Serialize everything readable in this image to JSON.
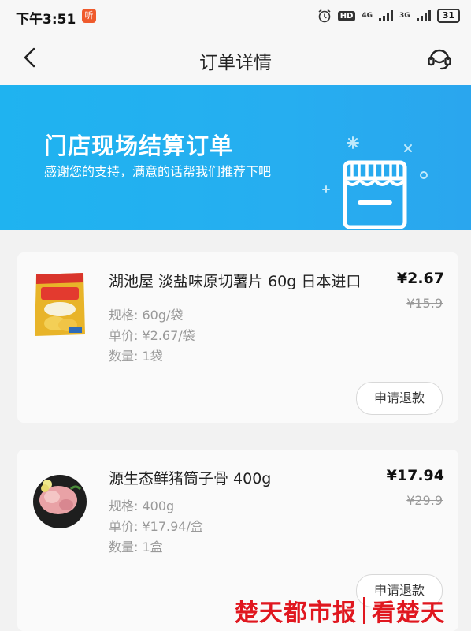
{
  "status_bar": {
    "time": "下午3:51",
    "notification_badge": "听",
    "hd": "HD",
    "network_1": "4G",
    "network_2": "3G",
    "battery": "31"
  },
  "nav": {
    "title": "订单详情",
    "back_icon": "chevron-left-icon",
    "service_icon": "customer-service-icon"
  },
  "banner": {
    "headline": "门店现场结算订单",
    "subtitle": "感谢您的支持，满意的话帮我们推荐下吧",
    "illustration_icon": "storefront-icon",
    "background": "#22aef0"
  },
  "products": [
    {
      "name": "湖池屋 淡盐味原切薯片 60g 日本进口",
      "price": "¥2.67",
      "original_price": "¥15.9",
      "spec": "规格: 60g/袋",
      "unit_price": "单价: ¥2.67/袋",
      "quantity": "数量: 1袋",
      "refund_label": "申请退款"
    },
    {
      "name": "源生态鲜猪筒子骨 400g",
      "price": "¥17.94",
      "original_price": "¥29.9",
      "spec": "规格: 400g",
      "unit_price": "单价: ¥17.94/盒",
      "quantity": "数量: 1盒",
      "refund_label": "申请退款"
    }
  ],
  "watermark": {
    "left": "楚天都市报",
    "right": "看楚天"
  }
}
